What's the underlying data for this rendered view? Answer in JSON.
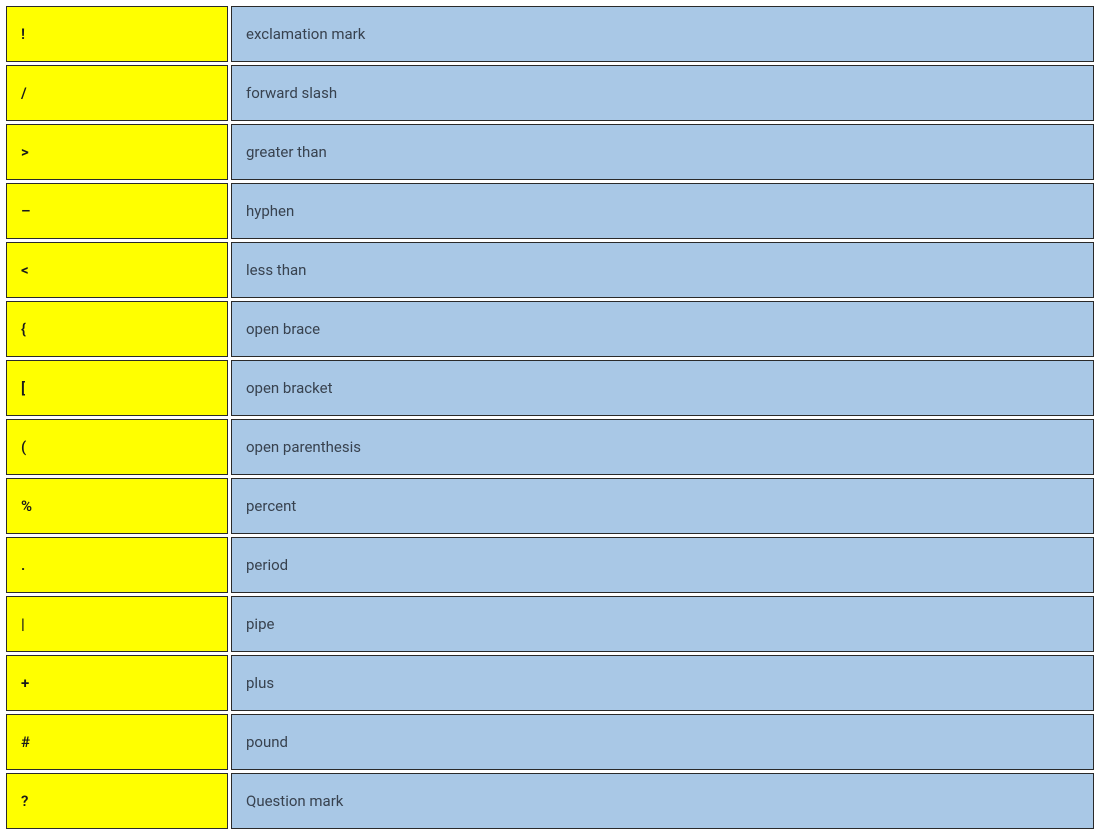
{
  "rows": [
    {
      "symbol": "!",
      "name": "exclamation mark"
    },
    {
      "symbol": "/",
      "name": "forward slash"
    },
    {
      "symbol": ">",
      "name": "greater than"
    },
    {
      "symbol": "–",
      "name": "hyphen"
    },
    {
      "symbol": "<",
      "name": "less than"
    },
    {
      "symbol": "{",
      "name": "open brace"
    },
    {
      "symbol": "[",
      "name": "open bracket"
    },
    {
      "symbol": "(",
      "name": "open parenthesis"
    },
    {
      "symbol": "%",
      "name": "percent"
    },
    {
      "symbol": ".",
      "name": "period"
    },
    {
      "symbol": "|",
      "name": "pipe"
    },
    {
      "symbol": "+",
      "name": "plus"
    },
    {
      "symbol": "#",
      "name": "pound"
    },
    {
      "symbol": "?",
      "name": "Question mark"
    }
  ]
}
